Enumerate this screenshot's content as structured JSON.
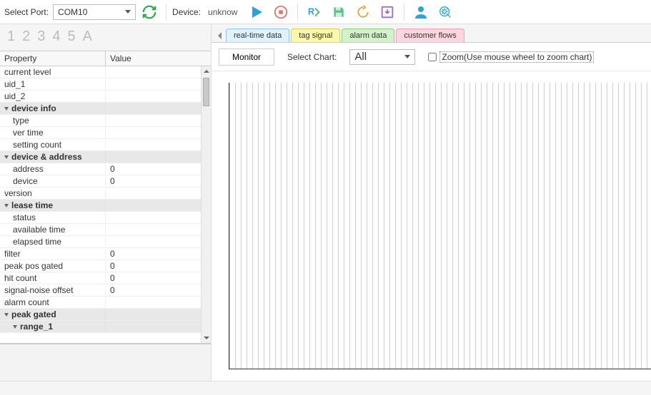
{
  "toolbar": {
    "select_port_label": "Select Port:",
    "port_value": "COM10",
    "device_label": "Device:",
    "device_value": "unknow"
  },
  "digits": [
    "1",
    "2",
    "3",
    "4",
    "5",
    "A"
  ],
  "grid": {
    "head_property": "Property",
    "head_value": "Value",
    "rows": [
      {
        "label": "current level",
        "value": "",
        "type": "row",
        "indent": 0
      },
      {
        "label": "uid_1",
        "value": "",
        "type": "row",
        "indent": 0
      },
      {
        "label": "uid_2",
        "value": "",
        "type": "row",
        "indent": 0
      },
      {
        "label": "device info",
        "value": "",
        "type": "group",
        "indent": 0
      },
      {
        "label": "type",
        "value": "",
        "type": "row",
        "indent": 1
      },
      {
        "label": "ver time",
        "value": "",
        "type": "row",
        "indent": 1
      },
      {
        "label": "setting count",
        "value": "",
        "type": "row",
        "indent": 1
      },
      {
        "label": "device & address",
        "value": "",
        "type": "group",
        "indent": 0
      },
      {
        "label": "address",
        "value": "0",
        "type": "row",
        "indent": 1
      },
      {
        "label": "device",
        "value": "0",
        "type": "row",
        "indent": 1
      },
      {
        "label": "version",
        "value": "",
        "type": "row",
        "indent": 0
      },
      {
        "label": "lease time",
        "value": "",
        "type": "group",
        "indent": 0
      },
      {
        "label": "status",
        "value": "",
        "type": "row",
        "indent": 1
      },
      {
        "label": "available time",
        "value": "",
        "type": "row",
        "indent": 1
      },
      {
        "label": "elapsed time",
        "value": "",
        "type": "row",
        "indent": 1
      },
      {
        "label": "filter",
        "value": "0",
        "type": "row",
        "indent": 0
      },
      {
        "label": "peak pos gated",
        "value": "0",
        "type": "row",
        "indent": 0
      },
      {
        "label": "hit count",
        "value": "0",
        "type": "row",
        "indent": 0
      },
      {
        "label": "signal-noise offset",
        "value": "0",
        "type": "row",
        "indent": 0
      },
      {
        "label": "alarm count",
        "value": "",
        "type": "row",
        "indent": 0
      },
      {
        "label": "peak gated",
        "value": "",
        "type": "group",
        "indent": 0
      },
      {
        "label": "range_1",
        "value": "",
        "type": "group",
        "indent": 1
      }
    ]
  },
  "tabs": [
    {
      "label": "real-time data",
      "style": "active"
    },
    {
      "label": "tag signal",
      "style": "yellow"
    },
    {
      "label": "alarm data",
      "style": "green"
    },
    {
      "label": "customer flows",
      "style": "pink"
    }
  ],
  "subbar": {
    "monitor": "Monitor",
    "select_chart_label": "Select Chart:",
    "select_chart_value": "All",
    "zoom_label": "Zoom(Use mouse wheel to zoom chart)"
  }
}
